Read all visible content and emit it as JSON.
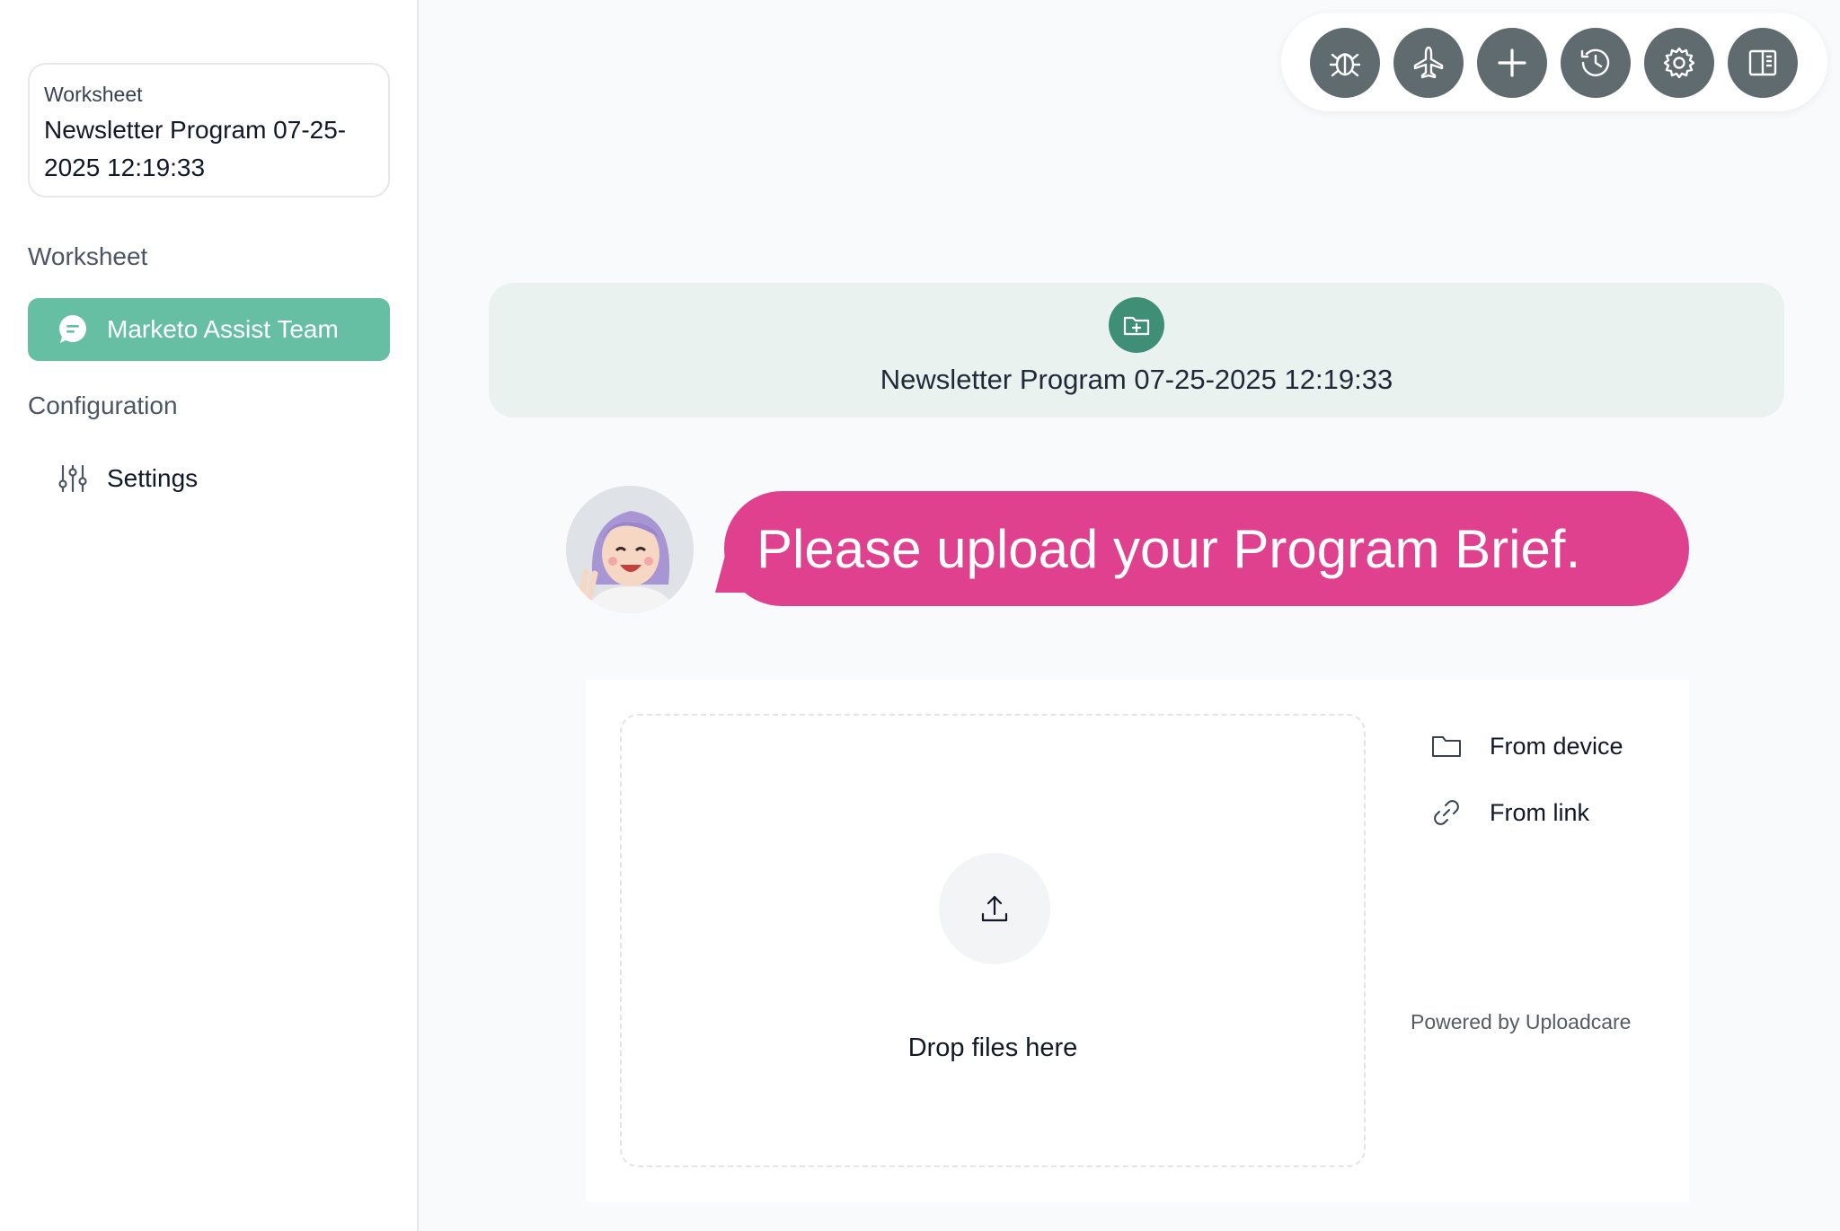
{
  "sidebar": {
    "card": {
      "label": "Worksheet",
      "title": "Newsletter Program 07-25-2025 12:19:33"
    },
    "section_worksheet": "Worksheet",
    "active_item": {
      "label": "Marketo Assist Team",
      "icon": "chat-bubble-icon"
    },
    "section_configuration": "Configuration",
    "settings_item": {
      "label": "Settings",
      "icon": "sliders-icon"
    }
  },
  "toolbar": {
    "buttons": [
      "bug-icon",
      "airplane-icon",
      "plus-icon",
      "history-icon",
      "gear-icon",
      "panel-icon"
    ],
    "color": "#5f6b6e"
  },
  "banner": {
    "title": "Newsletter Program 07-25-2025 12:19:33",
    "icon": "folder-plus-icon",
    "color": "#3f8f77"
  },
  "chat": {
    "message": "Please upload your Program Brief.",
    "bubble_color": "#e0418f"
  },
  "uploader": {
    "drop_label": "Drop files here",
    "sources": [
      {
        "label": "From device",
        "icon": "folder-icon"
      },
      {
        "label": "From link",
        "icon": "link-icon"
      }
    ],
    "powered_by": "Powered by Uploadcare"
  }
}
